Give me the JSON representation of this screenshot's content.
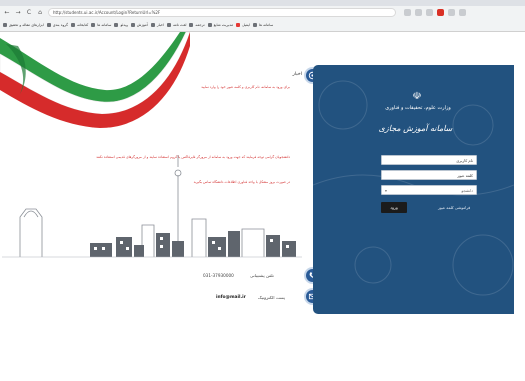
{
  "browser": {
    "url": "http://students.ui.ac.ir/Account/Login?ReturnUrl=%2F",
    "nav": {
      "back": "←",
      "forward": "→",
      "reload": "C",
      "home": "⌂"
    },
    "bookmarks": [
      "ابزارهای مقاله و تحقیق",
      "گروه بندی",
      "کتابخانه",
      "سامانه ها",
      "ویدئو",
      "آموزش",
      "اخبار",
      "لغت نامه",
      "ترجمه",
      "مدیریت منابع",
      "ایمیل",
      "سامانه ها"
    ]
  },
  "info": {
    "news_label": "اخبار",
    "red_lines_1": "برای ورود به سامانه، نام کاربری و کلمه عبور خود را وارد نمایید",
    "red_lines_2": "دانشجویان گرامی توجه فرمایند که جهت ورود به سامانه از مرورگر فایرفاکس یا کروم استفاده نمایند و از مرورگرهای قدیمی استفاده نکنند",
    "red_lines_3": "در صورت بروز مشکل با واحد فناوری اطلاعات دانشگاه تماس بگیرید",
    "phone_label": "تلفن پشتیبانی",
    "phone_value": "031-37930000",
    "email_label": "پست الکترونیک",
    "email_value": "info@mail.ir"
  },
  "login": {
    "title1": "وزارت علوم، تحقیقات و فناوری",
    "title2": "سامانه آموزش مجازی",
    "username": "نام کاربری",
    "password": "کلمه عبور",
    "select": "دانشجو",
    "button": "ورود",
    "forgot": "فراموشی کلمه عبور"
  },
  "colors": {
    "panel": "#22527f",
    "accent_red": "#d32f2f",
    "icon_circle": "#2a5b97"
  }
}
